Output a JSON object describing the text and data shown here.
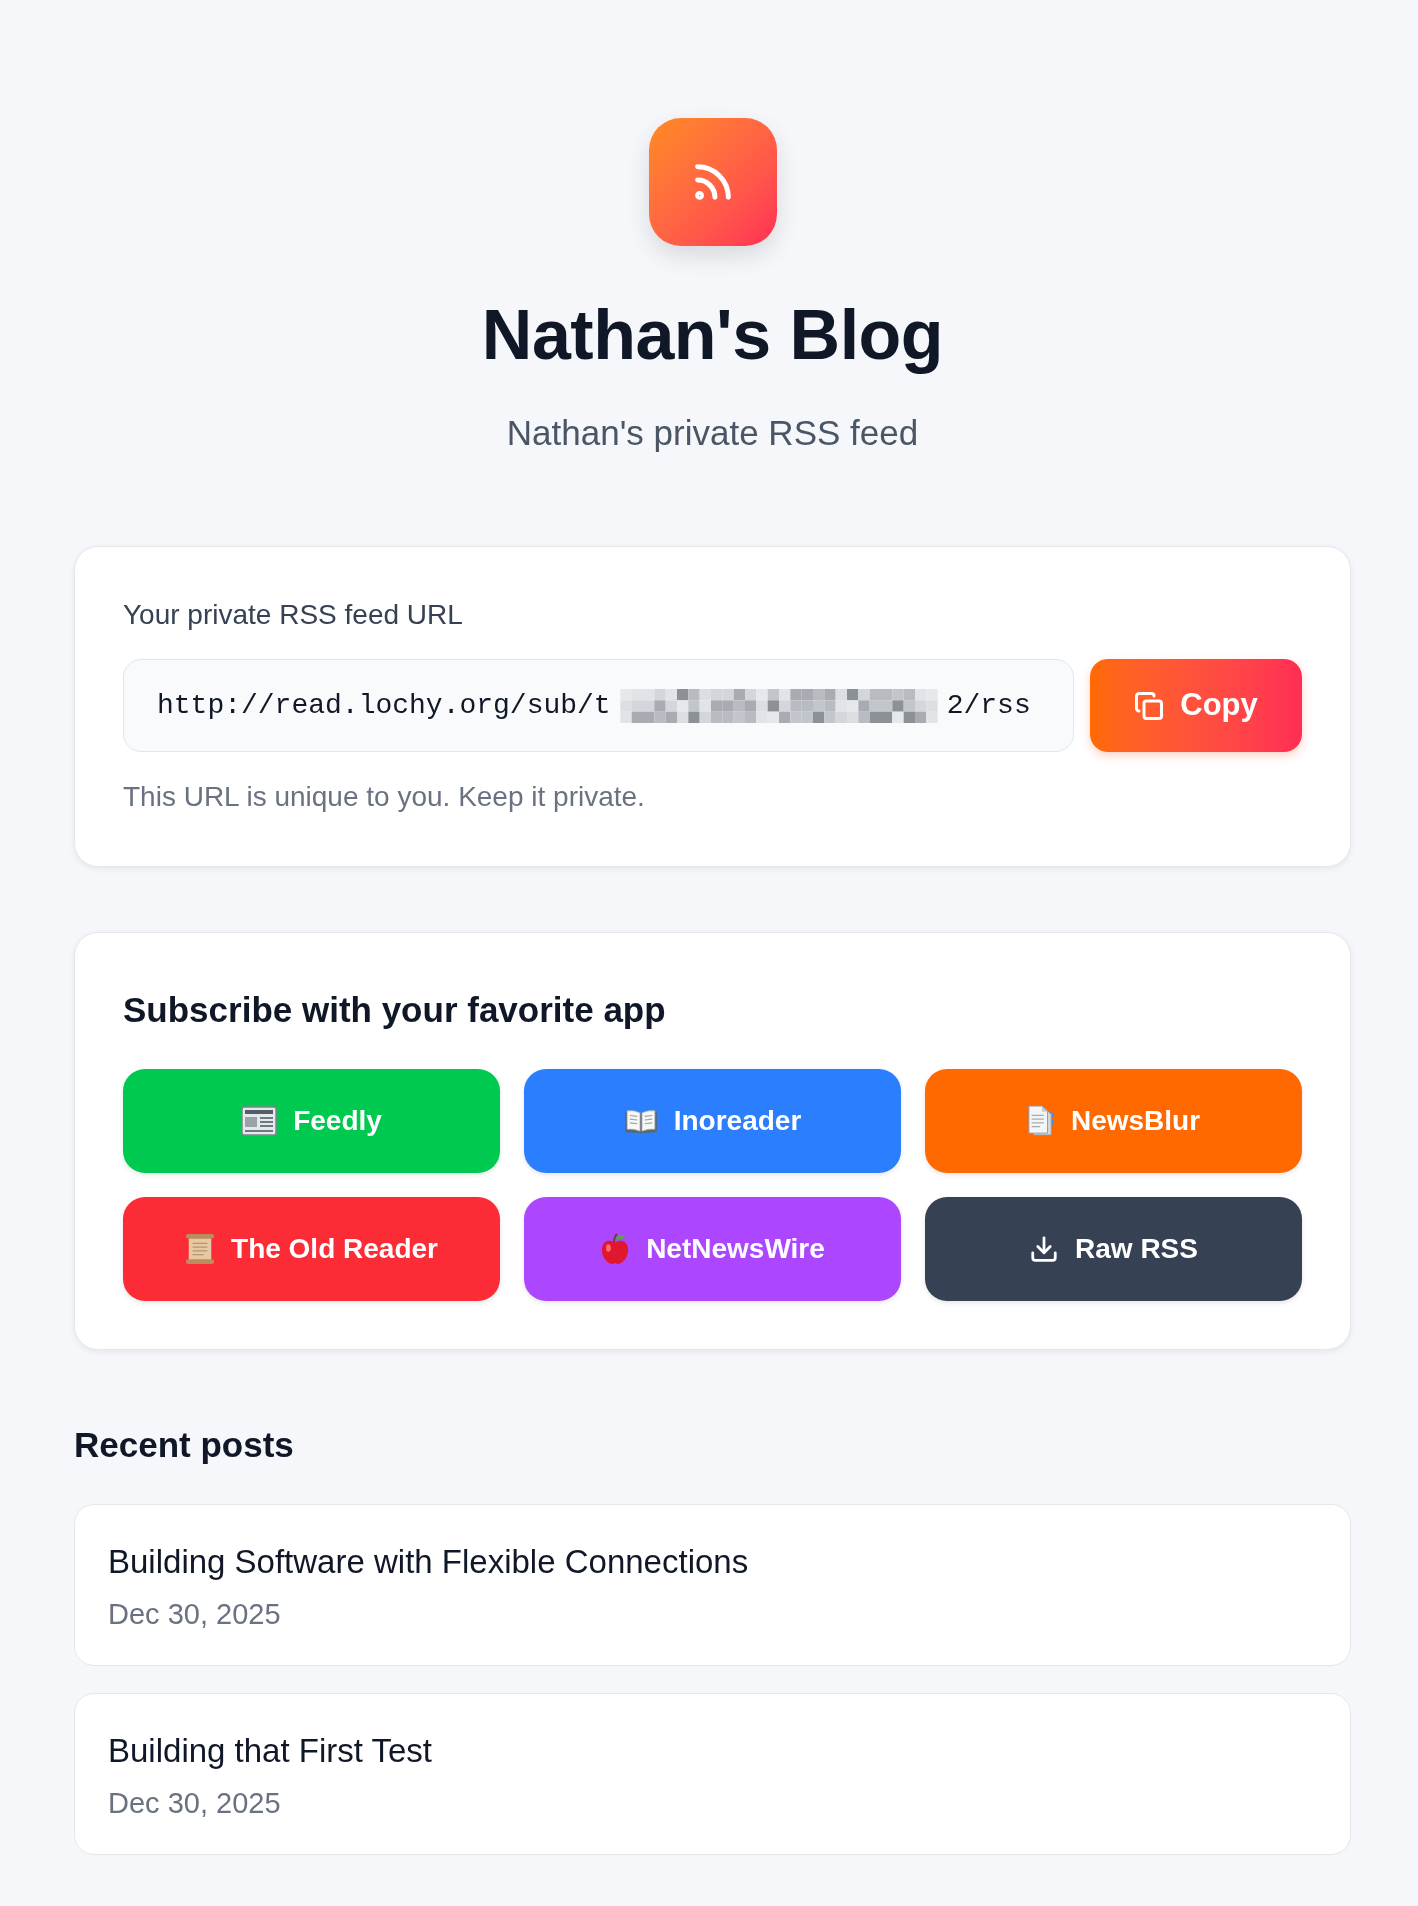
{
  "header": {
    "title": "Nathan's Blog",
    "subtitle": "Nathan's private RSS feed"
  },
  "feed_url": {
    "label": "Your private RSS feed URL",
    "value_start": "http://read.lochy.org/sub/t",
    "redacted": true,
    "value_end": "2/rss",
    "copy_button": "Copy",
    "hint": "This URL is unique to you. Keep it private."
  },
  "subscribe": {
    "title": "Subscribe with your favorite app",
    "apps": [
      {
        "label": "Feedly",
        "color": "#00c950"
      },
      {
        "label": "Inoreader",
        "color": "#2b7fff"
      },
      {
        "label": "NewsBlur",
        "color": "#ff6900"
      },
      {
        "label": "The Old Reader",
        "color": "#fb2c36"
      },
      {
        "label": "NetNewsWire",
        "color": "#ad46ff"
      },
      {
        "label": "Raw RSS",
        "color": "#364153"
      }
    ]
  },
  "recent_posts": {
    "title": "Recent posts",
    "posts": [
      {
        "title": "Building Software with Flexible Connections",
        "date": "Dec 30, 2025"
      },
      {
        "title": "Building that First Test",
        "date": "Dec 30, 2025"
      }
    ]
  }
}
